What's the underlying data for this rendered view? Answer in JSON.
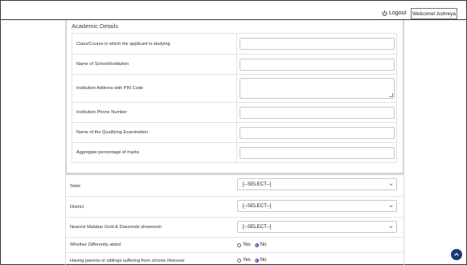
{
  "header": {
    "logout_label": "Logout",
    "welcome_text": "Welcome! Ashreya"
  },
  "academic": {
    "title": "Academic Details",
    "fields": [
      {
        "label": "Class/Course in which the applicant is studying",
        "value": ""
      },
      {
        "label": "Name of School/Institution",
        "value": ""
      },
      {
        "label": "Institution Address with PIN Code",
        "value": ""
      },
      {
        "label": "Institution Phone Number",
        "value": ""
      },
      {
        "label": "Name of the Qualifying Examination",
        "value": ""
      },
      {
        "label": "Aggregate percentage of marks",
        "value": ""
      }
    ]
  },
  "location": {
    "state": {
      "label": "State",
      "selected": "[--SELECT--]"
    },
    "district": {
      "label": "District",
      "selected": "[--SELECT--]"
    },
    "showroom": {
      "label": "Nearest Malabar Gold & Diamonds showroom",
      "selected": "[--SELECT--]"
    }
  },
  "questions": {
    "differently_abled": {
      "label": "Whether Differently abled",
      "yes": "Yes",
      "no": "No",
      "selected": "No"
    },
    "chronic_illness": {
      "label": "Having parents or siblings suffering from chronic illnesses",
      "yes": "Yes",
      "no": "No",
      "selected": "No"
    }
  },
  "colors": {
    "radio_accent": "#7a3fbf",
    "scroll_button": "#1f3b7a"
  },
  "icons": {
    "logout": "power-icon",
    "scroll": "arrow-up-icon",
    "select": "chevron-down-icon"
  }
}
